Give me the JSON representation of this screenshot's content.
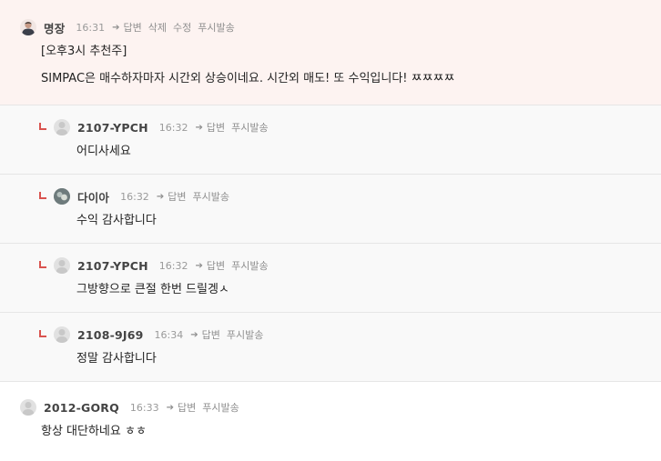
{
  "comments": [
    {
      "author": "명장",
      "time": "16:31",
      "actions": {
        "reply": "답변",
        "delete": "삭제",
        "edit": "수정",
        "push": "푸시발송"
      },
      "lines": [
        "[오후3시 추천주]",
        "SIMPAC은 매수하자마자 시간외 상승이네요. 시간외 매도! 또 수익입니다! ㅉㅉㅉㅉ"
      ]
    },
    {
      "author": "2107-YPCH",
      "time": "16:32",
      "actions": {
        "reply": "답변",
        "push": "푸시발송"
      },
      "text": "어디사세요"
    },
    {
      "author": "다이아",
      "time": "16:32",
      "actions": {
        "reply": "답변",
        "push": "푸시발송"
      },
      "text": "수익 감사합니다"
    },
    {
      "author": "2107-YPCH",
      "time": "16:32",
      "actions": {
        "reply": "답변",
        "push": "푸시발송"
      },
      "text": "그방향으로 큰절 한번 드릴겡ㅅ"
    },
    {
      "author": "2108-9J69",
      "time": "16:34",
      "actions": {
        "reply": "답변",
        "push": "푸시발송"
      },
      "text": "정말 감사합니다"
    },
    {
      "author": "2012-GORQ",
      "time": "16:33",
      "actions": {
        "reply": "답변",
        "push": "푸시발송"
      },
      "text": "항상 대단하네요 ㅎㅎ"
    }
  ],
  "icons": {
    "reply_arrow": "arrow-right-icon",
    "reply_mark": "reply-corner-icon",
    "default_avatar": "user-silhouette-icon"
  },
  "colors": {
    "highlight_bg": "#fdf3f1",
    "reply_bg": "#f9f9f9",
    "reply_mark": "#d9534f",
    "divider": "#e6e6e6"
  }
}
